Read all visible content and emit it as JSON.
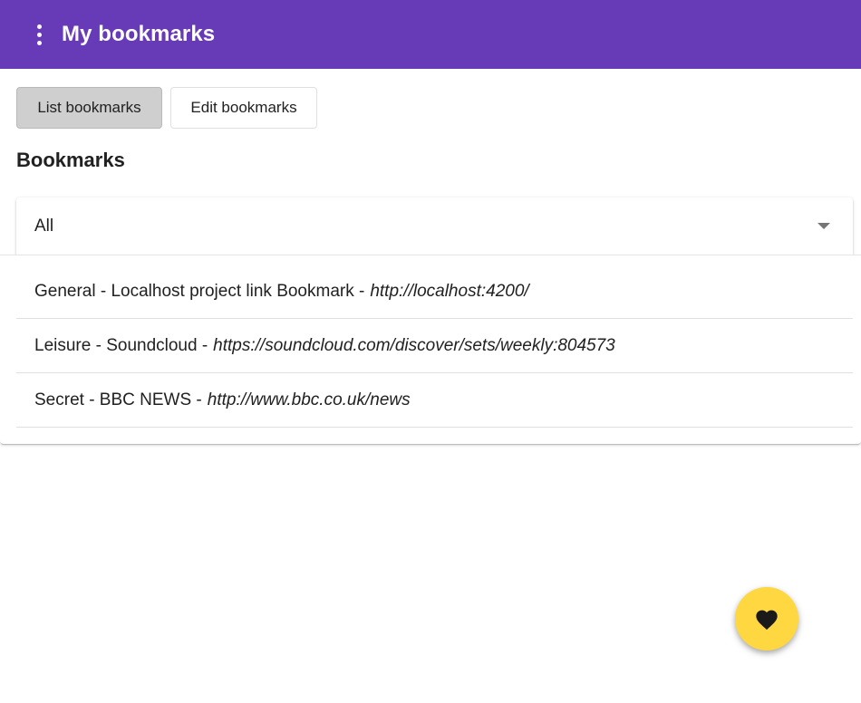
{
  "toolbar": {
    "title": "My bookmarks",
    "menu_icon": "more-vert-icon"
  },
  "buttons": {
    "list_label": "List bookmarks",
    "edit_label": "Edit bookmarks"
  },
  "section": {
    "title": "Bookmarks"
  },
  "filter": {
    "selected": "All",
    "icon": "dropdown-arrow-icon"
  },
  "bookmarks": [
    {
      "label": "General - Localhost project link Bookmark -",
      "url": "http://localhost:4200/"
    },
    {
      "label": "Leisure - Soundcloud -",
      "url": "https://soundcloud.com/discover/sets/weekly:804573"
    },
    {
      "label": "Secret - BBC NEWS -",
      "url": "http://www.bbc.co.uk/news"
    }
  ],
  "fab": {
    "icon": "heart-icon"
  },
  "colors": {
    "primary": "#673ab7",
    "accent": "#ffd740",
    "active_button": "#cfcfcf"
  }
}
